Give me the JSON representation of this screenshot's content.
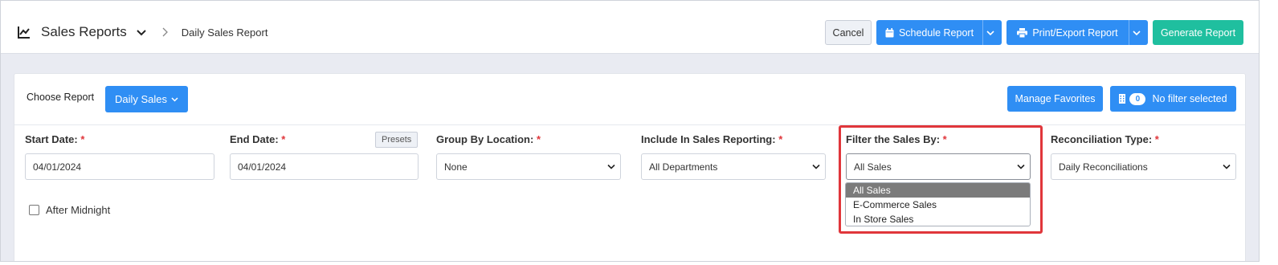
{
  "header": {
    "title": "Sales Reports",
    "breadcrumb": "Daily Sales Report",
    "buttons": {
      "cancel": "Cancel",
      "schedule": "Schedule Report",
      "print": "Print/Export Report",
      "generate": "Generate Report"
    }
  },
  "toolbar": {
    "choose_label": "Choose Report",
    "choose_value": "Daily Sales",
    "favorites": "Manage Favorites",
    "filter_count": "0",
    "filter_text": "No filter selected"
  },
  "fields": {
    "start_date": {
      "label": "Start Date:",
      "required": "*",
      "value": "04/01/2024"
    },
    "end_date": {
      "label": "End Date:",
      "required": "*",
      "value": "04/01/2024",
      "presets": "Presets"
    },
    "group_by": {
      "label": "Group By Location:",
      "required": "*",
      "value": "None"
    },
    "include": {
      "label": "Include In Sales Reporting:",
      "required": "*",
      "value": "All Departments"
    },
    "filter_sales": {
      "label": "Filter the Sales By:",
      "required": "*",
      "value": "All Sales",
      "options": [
        "All Sales",
        "E-Commerce Sales",
        "In Store Sales"
      ]
    },
    "reconciliation": {
      "label": "Reconciliation Type:",
      "required": "*",
      "value": "Daily Reconciliations"
    }
  },
  "after_midnight": "After Midnight",
  "colors": {
    "primary": "#2f8ef4",
    "teal": "#1fbf9f",
    "required": "#e0363b",
    "highlight": "#e0363b"
  }
}
